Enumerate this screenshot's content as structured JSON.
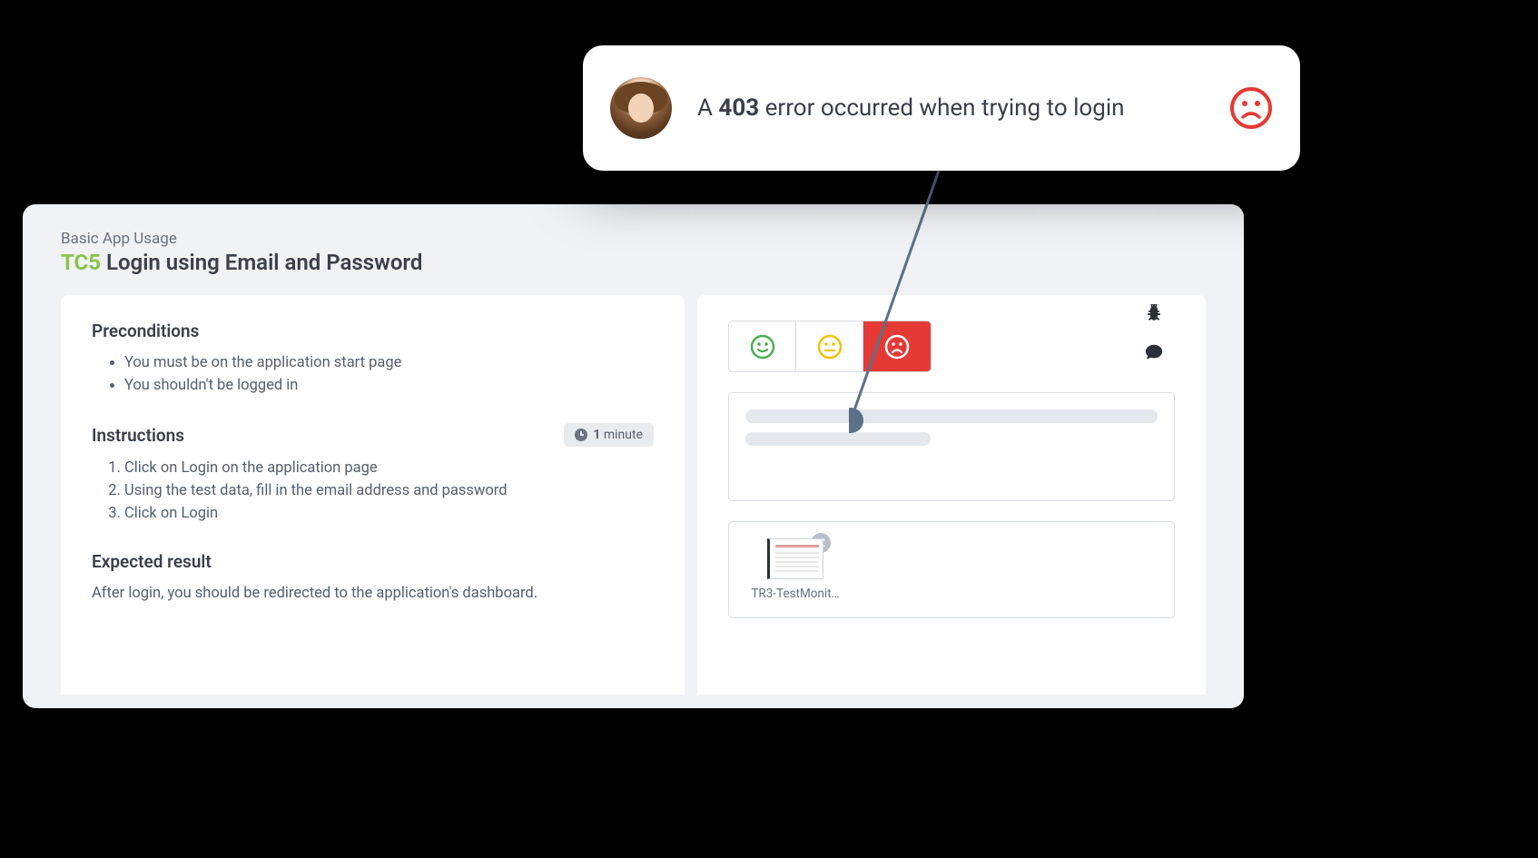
{
  "callout": {
    "text_prefix": "A ",
    "bold": "403",
    "text_suffix": " error occurred when trying to login"
  },
  "breadcrumb": "Basic App Usage",
  "title": {
    "id": "TC5",
    "name": "Login using Email and Password"
  },
  "preconditions": {
    "heading": "Preconditions",
    "items": [
      "You must be on the application start page",
      "You shouldn't be logged in"
    ]
  },
  "instructions": {
    "heading": "Instructions",
    "time": {
      "value": "1",
      "unit": "minute"
    },
    "steps": [
      "Click on Login on the application page",
      "Using the test data, fill in the email address and password",
      "Click on Login"
    ]
  },
  "expected": {
    "heading": "Expected result",
    "text": "After login, you should be redirected to the application's dashboard."
  },
  "attachment": {
    "name": "TR3-TestMonit…"
  },
  "colors": {
    "happy": "#4caf50",
    "neutral": "#f2c200",
    "sad": "#e53935"
  }
}
